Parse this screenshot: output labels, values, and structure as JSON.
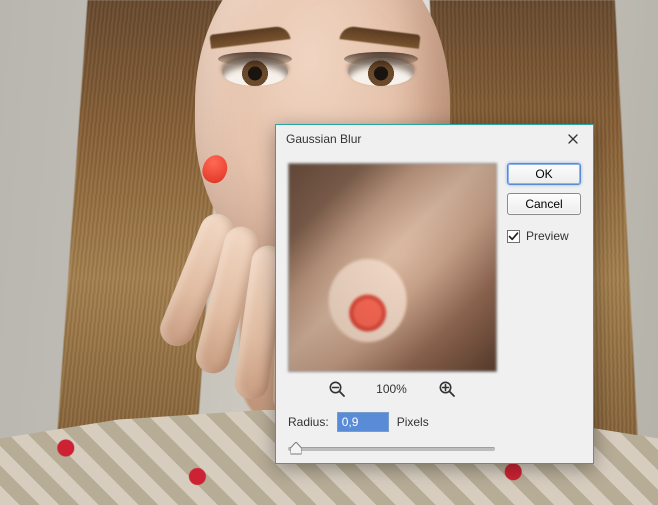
{
  "dialog": {
    "title": "Gaussian Blur",
    "ok_label": "OK",
    "cancel_label": "Cancel",
    "preview_label": "Preview",
    "preview_checked": true,
    "zoom_percent": "100%",
    "radius_label": "Radius:",
    "radius_value": "0,9",
    "radius_unit": "Pixels",
    "slider_fraction": 0.04
  },
  "icons": {
    "close": "close-icon",
    "zoom_out": "zoom-out-icon",
    "zoom_in": "zoom-in-icon",
    "checkbox_checked": "check-icon",
    "slider_thumb": "slider-thumb-icon"
  }
}
